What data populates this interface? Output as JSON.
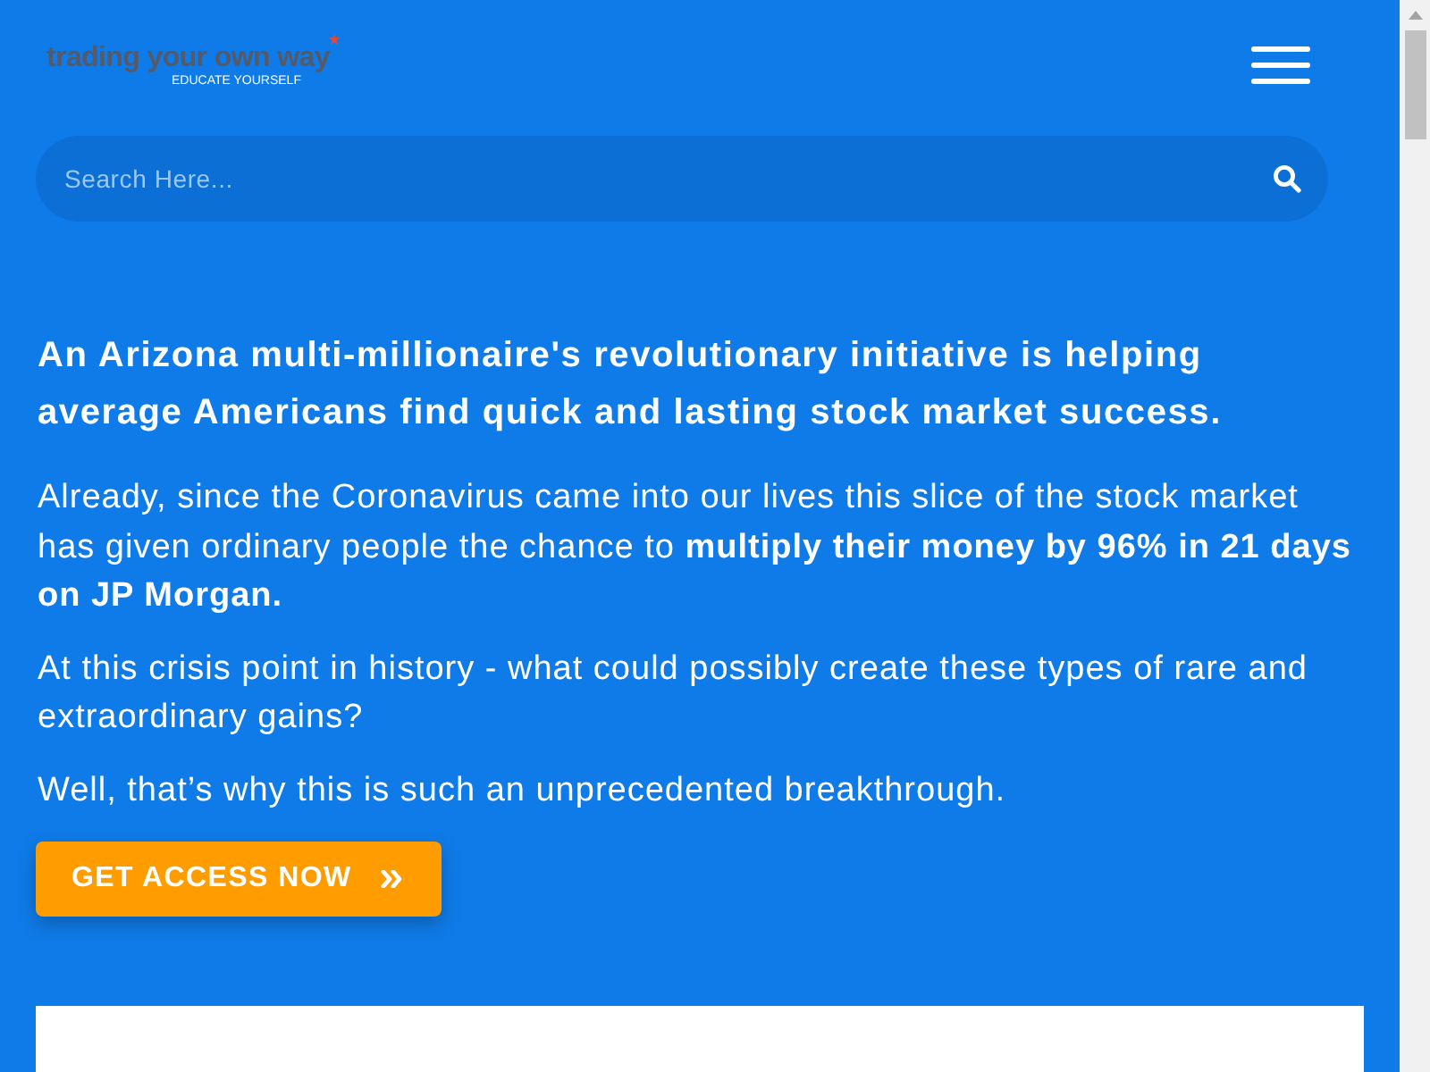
{
  "header": {
    "logo": {
      "name": "trading your own way",
      "tagline": "EDUCATE YOURSELF"
    }
  },
  "search": {
    "placeholder": "Search Here..."
  },
  "headline": "An Arizona multi-millionaire's revolutionary initiative is helping average Americans find quick and lasting stock market success.",
  "paragraphs": [
    "Already, since the Coronavirus came into our lives this slice of the stock market has given ordinary people the chance to **multiply their money by 96% in 21 days on JP Morgan.**",
    "At this crisis point in history - what could possibly create these types of rare and extraordinary gains?",
    "Well, that’s why this is such an unprecedented breakthrough."
  ],
  "cta_button": {
    "label": "GET ACCESS NOW"
  }
}
